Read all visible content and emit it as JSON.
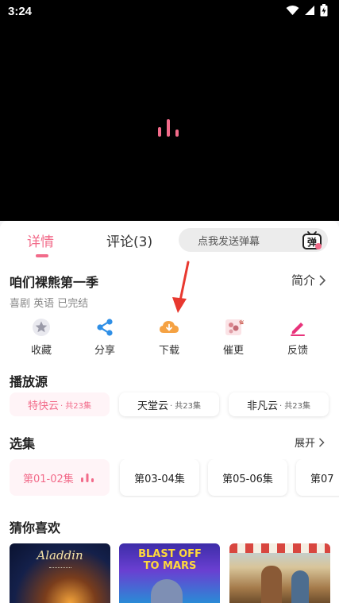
{
  "status_bar": {
    "time": "3:24",
    "icons": [
      "wifi-icon",
      "signal-icon",
      "battery-icon"
    ]
  },
  "player": {
    "state": "loading"
  },
  "tabs": [
    {
      "label": "详情",
      "active": true
    },
    {
      "label": "评论(3)",
      "active": false
    }
  ],
  "danmaku": {
    "placeholder": "点我发送弹幕",
    "icon_label": "弹"
  },
  "show": {
    "title": "咱们裸熊第一季",
    "intro_label": "简介",
    "meta": "喜剧 英语 已完结"
  },
  "actions": [
    {
      "label": "收藏",
      "icon": "star-icon"
    },
    {
      "label": "分享",
      "icon": "share-icon"
    },
    {
      "label": "下载",
      "icon": "download-cloud-icon"
    },
    {
      "label": "催更",
      "icon": "urge-update-icon"
    },
    {
      "label": "反馈",
      "icon": "feedback-pencil-icon"
    }
  ],
  "sources": {
    "title": "播放源",
    "items": [
      {
        "name": "特快云",
        "count": "· 共23集",
        "active": true
      },
      {
        "name": "天堂云",
        "count": "· 共23集",
        "active": false
      },
      {
        "name": "非凡云",
        "count": "· 共23集",
        "active": false
      }
    ]
  },
  "episodes": {
    "title": "选集",
    "expand_label": "展开",
    "items": [
      {
        "label": "第01-02集",
        "active": true
      },
      {
        "label": "第03-04集",
        "active": false
      },
      {
        "label": "第05-06集",
        "active": false
      },
      {
        "label": "第07",
        "active": false
      }
    ]
  },
  "recommend": {
    "title": "猜你喜欢",
    "posters": [
      {
        "title": "Aladdin"
      },
      {
        "title": "BLAST OFF TO MARS"
      },
      {
        "title": ""
      }
    ]
  },
  "colors": {
    "accent": "#f26b8a",
    "download": "#f5a243",
    "share": "#2f8fe6",
    "feedback": "#e8337b"
  }
}
